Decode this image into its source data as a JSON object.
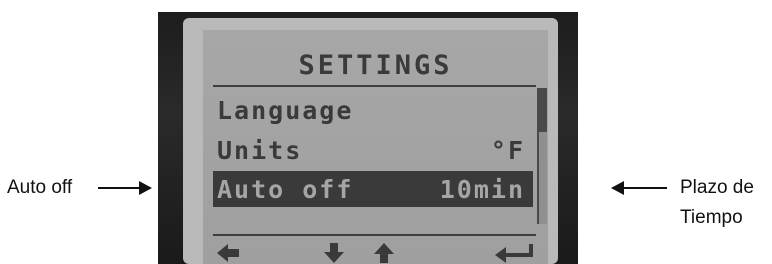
{
  "callouts": {
    "left": "Auto off",
    "right_line1": "Plazo de",
    "right_line2": "Tiempo"
  },
  "screen": {
    "title": "SETTINGS",
    "rows": [
      {
        "label": "Language",
        "value": "",
        "selected": false
      },
      {
        "label": "Units",
        "value": "°F",
        "selected": false
      },
      {
        "label": "Auto off",
        "value": "10min",
        "selected": true
      }
    ],
    "scroll_position": 0.0,
    "softkeys": [
      "left-arrow-icon",
      "down-arrow-icon",
      "up-arrow-icon",
      "enter-return-icon"
    ]
  },
  "colors": {
    "lcd_background": "#a5a5a5",
    "lcd_text": "#3a3a3a",
    "bezel": "#1f1f1f"
  }
}
